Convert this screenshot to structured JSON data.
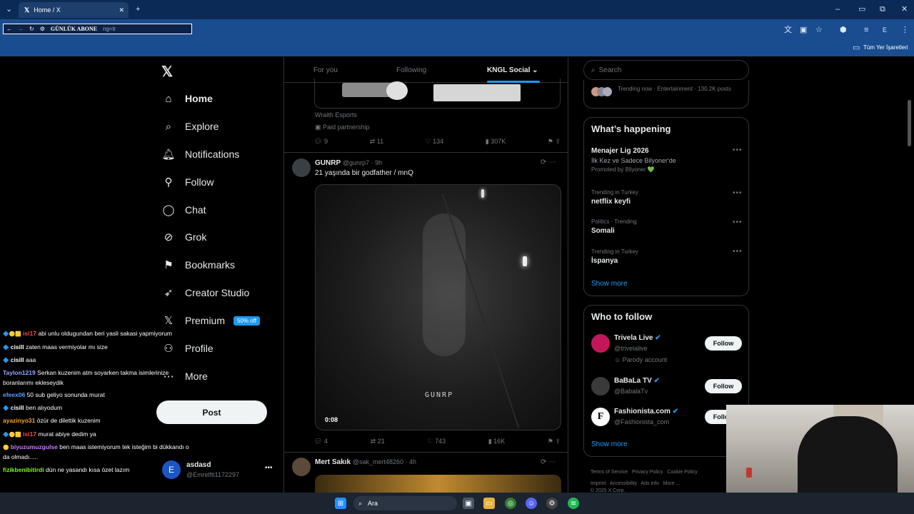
{
  "browser": {
    "tab_title": "Home / X",
    "address_text": "GÜNLÜK ABONE",
    "address_suffix": "ng=tr",
    "bookmarks_label": "Tüm Yer İşaretleri"
  },
  "nav": {
    "items": [
      {
        "label": "Home"
      },
      {
        "label": "Explore"
      },
      {
        "label": "Notifications"
      },
      {
        "label": "Follow"
      },
      {
        "label": "Chat"
      },
      {
        "label": "Grok"
      },
      {
        "label": "Bookmarks"
      },
      {
        "label": "Creator Studio"
      },
      {
        "label": "Premium"
      },
      {
        "label": "Profile"
      },
      {
        "label": "More"
      }
    ],
    "premium_badge": "50% off",
    "post_label": "Post",
    "account_name": "asdasd",
    "account_handle": "@Emrelfti1172297",
    "account_initial": "E"
  },
  "timeline": {
    "tabs": [
      "For you",
      "Following",
      "KNGL Social"
    ],
    "ad": {
      "source": "Wraith Esports",
      "paid_label": "Paid partnership",
      "replies": "9",
      "reposts": "11",
      "likes": "134",
      "views": "307K"
    },
    "tweet1": {
      "name": "GUNRP",
      "handle": "@gunrp7 · 9h",
      "text": "21 yaşında bir godfather / mnQ",
      "video_time": "0:08",
      "watermark": "GUNRP",
      "replies": "4",
      "reposts": "21",
      "likes": "743",
      "views": "16K"
    },
    "tweet2": {
      "name": "Mert Sakık",
      "handle": "@sak_mert48260 · 4h"
    }
  },
  "sidebar": {
    "search_placeholder": "Search",
    "trending_now": "Trending now · Entertainment · 130.2K posts",
    "happening_title": "What’s happening",
    "trends": [
      {
        "context": "",
        "title": "Menajer Lig 2026",
        "sub": "İlk Kez ve Sadece Bilyoner'de",
        "promo": "Promoted by Bilyoner 💚"
      },
      {
        "context": "Trending in Turkey",
        "title": "netflix keyfi"
      },
      {
        "context": "Politics · Trending",
        "title": "Somali"
      },
      {
        "context": "Trending in Turkey",
        "title": "İspanya"
      }
    ],
    "show_more": "Show more",
    "who_to_follow_title": "Who to follow",
    "follows": [
      {
        "name": "Trivela Live",
        "handle": "@trivelalive",
        "note": "Parody account",
        "button": "Follow",
        "avatar_color": "#c2185b"
      },
      {
        "name": "BaBaLa TV",
        "handle": "@BabalaTv",
        "note": "",
        "button": "Follow",
        "avatar_color": "#3a3a3a"
      },
      {
        "name": "Fashionista.com",
        "handle": "@Fashionista_com",
        "note": "",
        "button": "Follow",
        "avatar_color": "#ffffff"
      }
    ],
    "footer_links": [
      "Terms of Service",
      "Privacy Policy",
      "Cookie Policy",
      "Imprint",
      "Accessibility",
      "Ads info",
      "More ..."
    ],
    "copyright": "© 2025 X Corp."
  },
  "chat": [
    {
      "user": "isi17",
      "msg": "abi unlu oldugundan beri yasli sakasi yapmiyorum",
      "color": "#ff4b4b",
      "badges": "🔷🟡🟨"
    },
    {
      "user": "cisill",
      "msg": "zaten maas vermiyolar mı size",
      "color": "#ffffff",
      "badges": "🔷"
    },
    {
      "user": "cisill",
      "msg": "aaa",
      "color": "#ffffff",
      "badges": "🔷"
    },
    {
      "user": "Taylon1219",
      "msg": "Serkan kuzenim atm soyarken takma isimlerinize",
      "color": "#9aa7ff",
      "badges": ""
    },
    {
      "user": "",
      "msg": "boranlarımı ekleseydik",
      "color": "#ffffff",
      "badges": ""
    },
    {
      "user": "efeex06",
      "msg": "50 sub geliyo sonunda murat",
      "color": "#5aa0ff",
      "badges": ""
    },
    {
      "user": "cisill",
      "msg": "ben alıyodum",
      "color": "#ffffff",
      "badges": "🔷"
    },
    {
      "user": "ayazinyo31",
      "msg": "özür de dilettik kuzenim",
      "color": "#f5a623",
      "badges": ""
    },
    {
      "user": "isi17",
      "msg": "murat abiye dedim ya",
      "color": "#ff4b4b",
      "badges": "🔷🟡🟨"
    },
    {
      "user": "biyuzumuzgulse",
      "msg": "ben maas istemiyorum tek isteğim bi dükkandı o",
      "color": "#c77dff",
      "badges": "🟡"
    },
    {
      "user": "",
      "msg": "da olmadı.....",
      "color": "#ffffff",
      "badges": ""
    },
    {
      "user": "fizikbenibitirdi",
      "msg": "dün ne yasandı kısa özet lazım",
      "color": "#7cfc00",
      "badges": ""
    }
  ],
  "taskbar": {
    "search_label": "Ara"
  }
}
